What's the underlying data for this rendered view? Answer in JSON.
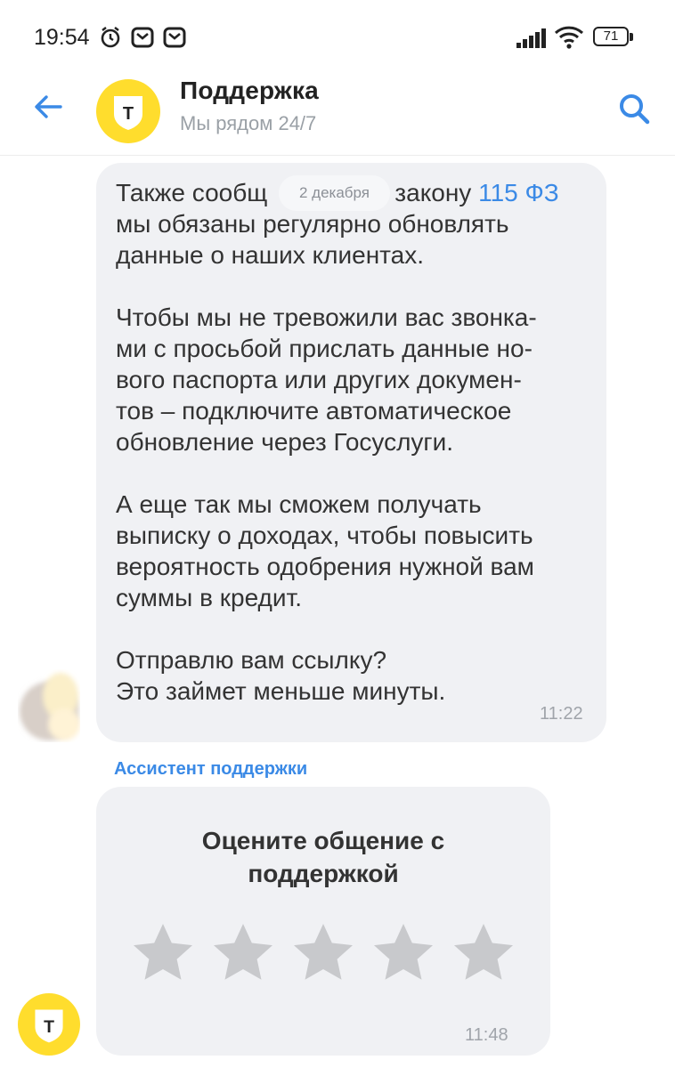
{
  "status_bar": {
    "time": "19:54",
    "battery": "71"
  },
  "header": {
    "title": "Поддержка",
    "subtitle": "Мы рядом 24/7",
    "logo_letter": "Т"
  },
  "date_chip": "2 декабря",
  "message": {
    "text_before_link": "Также сообщ",
    "text_mid": "закону ",
    "link_text": "115 ФЗ",
    "text_after": "\nмы обязаны регулярно обновлять\nданные о наших клиентах.\n\nЧтобы мы не тревожили вас звонка-\nми с просьбой прислать данные но-\nвого паспорта или других докумен-\nтов – подключите автоматическое\nобновление через Госуслуги.\n\nА еще так мы сможем получать\nвыписку о доходах, чтобы повысить\nвероятность одобрения нужной вам\nсуммы в кредит.\n\nОтправлю вам ссылку?\nЭто займет меньше минуты.",
    "time": "11:22"
  },
  "sender_label": "Ассистент поддержки",
  "rating_card": {
    "title": "Оцените общение с\nподдержкой",
    "stars_total": 5,
    "stars_selected": 0,
    "time": "11:48"
  },
  "colors": {
    "accent_blue": "#3b8ae6",
    "brand_yellow": "#ffdd2d",
    "bubble_bg": "#f0f1f4",
    "star_gray": "#c8c9cc"
  }
}
